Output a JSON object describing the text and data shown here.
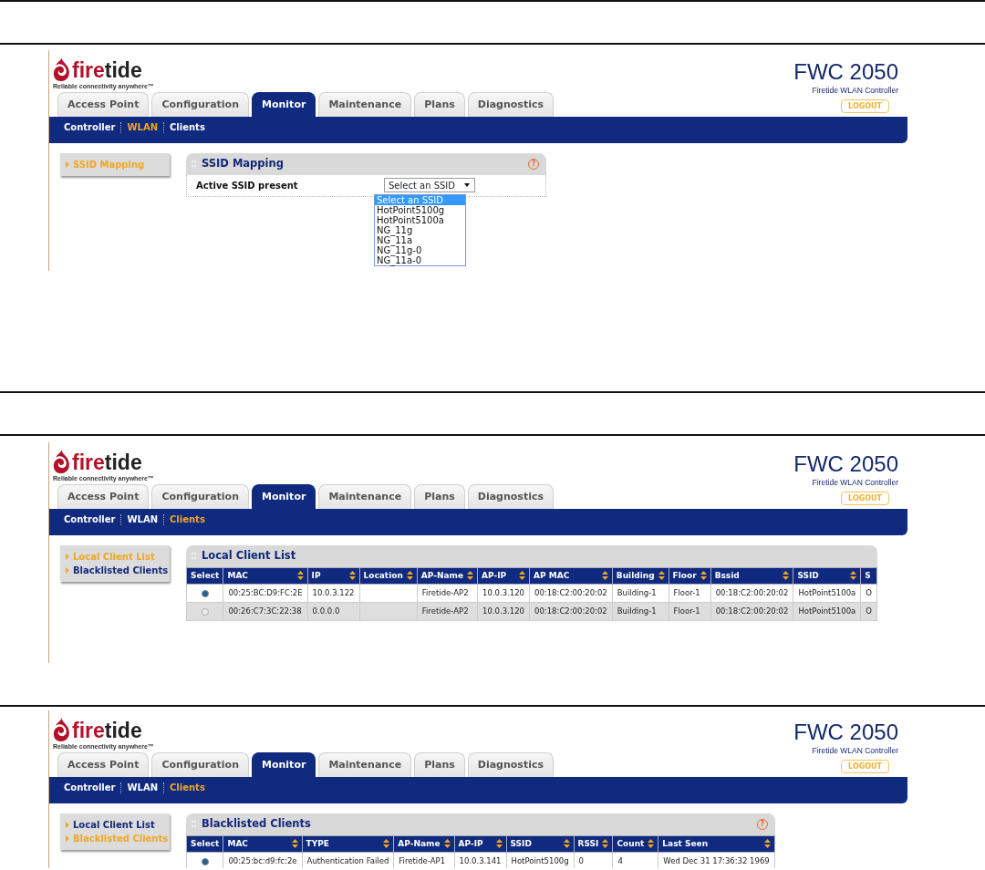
{
  "screens": [
    {
      "logo": {
        "parts": [
          "fire",
          "tide"
        ],
        "tagline": "Reliable connectivity anywhere™"
      },
      "product": {
        "title": "FWC 2050",
        "subtitle": "Firetide WLAN Controller"
      },
      "logout": "LOGOUT",
      "tabs": [
        {
          "label": "Access Point",
          "selected": false
        },
        {
          "label": "Configuration",
          "selected": false
        },
        {
          "label": "Monitor",
          "selected": true
        },
        {
          "label": "Maintenance",
          "selected": false
        },
        {
          "label": "Plans",
          "selected": false
        },
        {
          "label": "Diagnostics",
          "selected": false
        }
      ],
      "subnav": [
        {
          "label": "Controller",
          "selected": false
        },
        {
          "label": "WLAN",
          "selected": true
        },
        {
          "label": "Clients",
          "selected": false
        }
      ],
      "sidebar": [
        {
          "label": "SSID Mapping",
          "selected": true
        }
      ],
      "panel": {
        "kind": "form",
        "title": "SSID Mapping",
        "help": "?",
        "field": {
          "label": "Active SSID present",
          "value": "Select an SSID",
          "options": [
            {
              "label": "Select an SSID",
              "selected": true
            },
            {
              "label": "HotPoint5100g",
              "selected": false
            },
            {
              "label": "HotPoint5100a",
              "selected": false
            },
            {
              "label": "NG_11g",
              "selected": false
            },
            {
              "label": "NG_11a",
              "selected": false
            },
            {
              "label": "NG_11g-0",
              "selected": false
            },
            {
              "label": "NG_11a-0",
              "selected": false
            }
          ]
        }
      }
    },
    {
      "logo": {
        "parts": [
          "fire",
          "tide"
        ],
        "tagline": "Reliable connectivity anywhere™"
      },
      "product": {
        "title": "FWC 2050",
        "subtitle": "Firetide WLAN Controller"
      },
      "logout": "LOGOUT",
      "tabs": [
        {
          "label": "Access Point",
          "selected": false
        },
        {
          "label": "Configuration",
          "selected": false
        },
        {
          "label": "Monitor",
          "selected": true
        },
        {
          "label": "Maintenance",
          "selected": false
        },
        {
          "label": "Plans",
          "selected": false
        },
        {
          "label": "Diagnostics",
          "selected": false
        }
      ],
      "subnav": [
        {
          "label": "Controller",
          "selected": false
        },
        {
          "label": "WLAN",
          "selected": false
        },
        {
          "label": "Clients",
          "selected": true
        }
      ],
      "sidebar": [
        {
          "label": "Local Client List",
          "selected": true
        },
        {
          "label": "Blacklisted Clients",
          "selected": false
        }
      ],
      "panel": {
        "kind": "table",
        "title": "Local Client List",
        "columns": [
          {
            "label": "Select",
            "sortable": false
          },
          {
            "label": "MAC",
            "sortable": true
          },
          {
            "label": "IP",
            "sortable": true
          },
          {
            "label": "Location",
            "sortable": true
          },
          {
            "label": "AP-Name",
            "sortable": true
          },
          {
            "label": "AP-IP",
            "sortable": true
          },
          {
            "label": "AP MAC",
            "sortable": true
          },
          {
            "label": "Building",
            "sortable": true
          },
          {
            "label": "Floor",
            "sortable": true
          },
          {
            "label": "Bssid",
            "sortable": true
          },
          {
            "label": "SSID",
            "sortable": true
          },
          {
            "label": "S",
            "sortable": false
          }
        ],
        "rows": [
          {
            "selected": true,
            "cells": [
              "",
              "00:25:BC:D9:FC:2E",
              "10.0.3.122",
              "",
              "Firetide-AP2",
              "10.0.3.120",
              "00:18:C2:00:20:02",
              "Building-1",
              "Floor-1",
              "00:18:C2:00:20:02",
              "HotPoint5100a",
              "O"
            ]
          },
          {
            "selected": false,
            "cells": [
              "",
              "00:26:C7:3C:22:38",
              "0.0.0.0",
              "",
              "Firetide-AP2",
              "10.0.3.120",
              "00:18:C2:00:20:02",
              "Building-1",
              "Floor-1",
              "00:18:C2:00:20:02",
              "HotPoint5100a",
              "O"
            ]
          }
        ]
      }
    },
    {
      "logo": {
        "parts": [
          "fire",
          "tide"
        ],
        "tagline": "Reliable connectivity anywhere™"
      },
      "product": {
        "title": "FWC 2050",
        "subtitle": "Firetide WLAN Controller"
      },
      "logout": "LOGOUT",
      "tabs": [
        {
          "label": "Access Point",
          "selected": false
        },
        {
          "label": "Configuration",
          "selected": false
        },
        {
          "label": "Monitor",
          "selected": true
        },
        {
          "label": "Maintenance",
          "selected": false
        },
        {
          "label": "Plans",
          "selected": false
        },
        {
          "label": "Diagnostics",
          "selected": false
        }
      ],
      "subnav": [
        {
          "label": "Controller",
          "selected": false
        },
        {
          "label": "WLAN",
          "selected": false
        },
        {
          "label": "Clients",
          "selected": true
        }
      ],
      "sidebar": [
        {
          "label": "Local Client List",
          "selected": false
        },
        {
          "label": "Blacklisted Clients",
          "selected": true
        }
      ],
      "panel": {
        "kind": "table",
        "title": "Blacklisted Clients",
        "help": "?",
        "columns": [
          {
            "label": "Select",
            "sortable": false
          },
          {
            "label": "MAC",
            "sortable": true
          },
          {
            "label": "TYPE",
            "sortable": true
          },
          {
            "label": "AP-Name",
            "sortable": true
          },
          {
            "label": "AP-IP",
            "sortable": true
          },
          {
            "label": "SSID",
            "sortable": true
          },
          {
            "label": "RSSI",
            "sortable": true
          },
          {
            "label": "Count",
            "sortable": true
          },
          {
            "label": "Last Seen",
            "sortable": true
          }
        ],
        "rows": [
          {
            "selected": true,
            "cells": [
              "",
              "00:25:bc:d9:fc:2e",
              "Authentication Failed",
              "Firetide-AP1",
              "10.0.3.141",
              "HotPoint5100g",
              "0",
              "4",
              "Wed Dec 31 17:36:32 1969"
            ]
          }
        ]
      }
    }
  ]
}
